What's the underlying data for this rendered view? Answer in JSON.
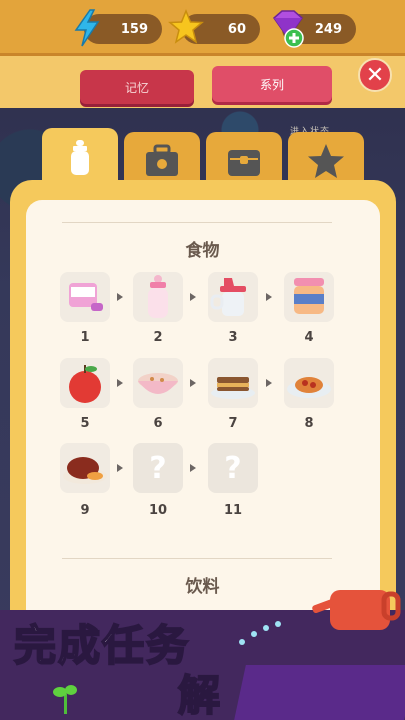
{
  "resources": {
    "energy": "159",
    "stars": "60",
    "gems": "249"
  },
  "tabs": {
    "memory": "记忆",
    "series": "系列"
  },
  "close_label": "✕",
  "hidden_hint": "进入状态",
  "categories": [
    "bottle-icon",
    "toolbox-icon",
    "chest-icon",
    "star-icon"
  ],
  "section_food": {
    "title": "食物",
    "items": [
      {
        "num": "1",
        "icon": "formula-can-icon",
        "locked": false
      },
      {
        "num": "2",
        "icon": "baby-bottle-icon",
        "locked": false
      },
      {
        "num": "3",
        "icon": "sippy-cup-icon",
        "locked": false
      },
      {
        "num": "4",
        "icon": "baby-food-jar-icon",
        "locked": false
      },
      {
        "num": "5",
        "icon": "apple-icon",
        "locked": false
      },
      {
        "num": "6",
        "icon": "cereal-bowl-icon",
        "locked": false
      },
      {
        "num": "7",
        "icon": "sandwich-icon",
        "locked": false
      },
      {
        "num": "8",
        "icon": "spaghetti-icon",
        "locked": false
      },
      {
        "num": "9",
        "icon": "roast-ham-icon",
        "locked": false
      },
      {
        "num": "10",
        "icon": "question-icon",
        "locked": true,
        "placeholder": "?"
      },
      {
        "num": "11",
        "icon": "question-icon",
        "locked": true,
        "placeholder": "?"
      }
    ]
  },
  "section_drinks": {
    "title": "饮料"
  },
  "promo": {
    "line1": "完成任务",
    "line2": "解"
  },
  "colors": {
    "accent_orange": "#e3a43b",
    "panel_yellow": "#f5c95c",
    "tab_red": "#e04e68",
    "close_red": "#e2414a"
  }
}
